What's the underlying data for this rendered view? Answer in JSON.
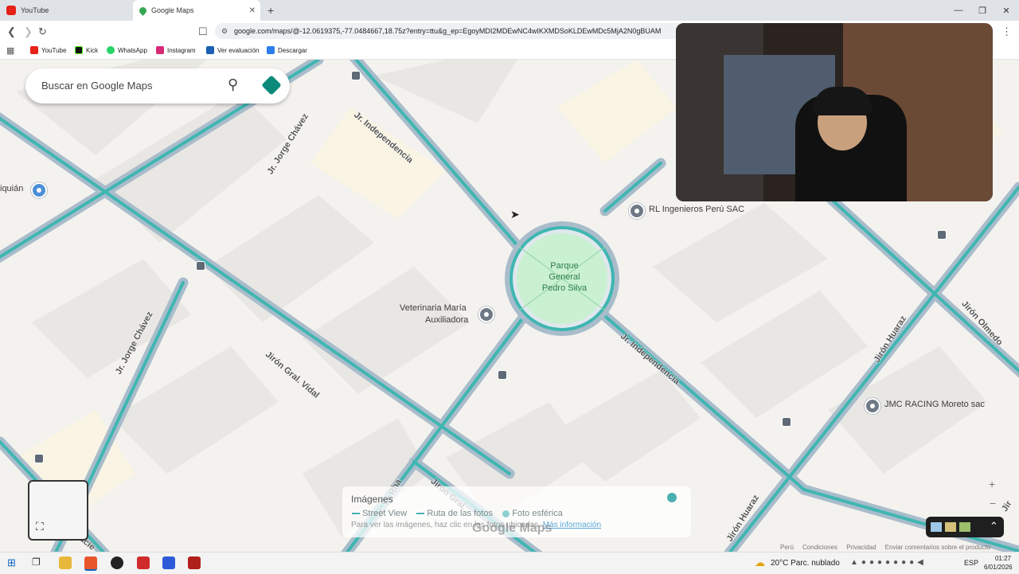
{
  "browser": {
    "tabs": [
      {
        "label": "YouTube",
        "icon": "youtube-icon",
        "active": false
      },
      {
        "label": "Google Maps",
        "icon": "maps-pin-icon",
        "active": true
      }
    ],
    "new_tab_symbol": "+",
    "url": "google.com/maps/@-12.0619375,-77.0484667,18.75z?entry=ttu&g_ep=EgoyMDI2MDEwNC4wIKXMDSoKLDEwMDc5MjA2N0gBUAM",
    "bookmarks": [
      {
        "label": "YouTube",
        "icon": "youtube-icon"
      },
      {
        "label": "Kick",
        "icon": "kick-icon"
      },
      {
        "label": "WhatsApp",
        "icon": "whatsapp-icon"
      },
      {
        "label": "Instagram",
        "icon": "instagram-icon"
      },
      {
        "label": "Ver evaluación",
        "icon": "doc-icon"
      },
      {
        "label": "Descargar",
        "icon": "download-icon"
      }
    ]
  },
  "search": {
    "placeholder": "Buscar en Google Maps"
  },
  "map": {
    "park": [
      "Parque",
      "General",
      "Pedro Silva"
    ],
    "places": [
      {
        "name": "RL Ingenieros Perú SAC"
      },
      {
        "name": "Veterinaria María"
      },
      {
        "name": "Auxiliadora"
      },
      {
        "name": "JMC RACING Moreto sac"
      },
      {
        "name": "iquián"
      }
    ],
    "streets": {
      "jorge_chavez_top": "Jr. Jorge Chávez",
      "jorge_chavez_bottom": "Jr. Jorge Chávez",
      "independencia_top": "Jr. Independencia",
      "independencia_bottom": "Jr. Independencia",
      "gral_vidal": "Jirón Gral. Vidal",
      "huaraz_right": "Jirón Huaraz",
      "huaraz_bottom": "Jirón Huaraz",
      "olmedo": "Jirón Olmedo",
      "gral_bottom": "Jirón Gral.",
      "bottom_partial": "Jr. Yy Rha",
      "bottom_left_partial": "racie",
      "right_edge_partial": "Jir"
    }
  },
  "imagery": {
    "title": "Imágenes",
    "legend": [
      "Street View",
      "Ruta de las fotos",
      "Foto esférica"
    ],
    "hint": "Para ver las imágenes, haz clic en las fotos ubicadas.",
    "link": "Más información",
    "watermark": "Google Maps"
  },
  "footer_links": [
    "Perú",
    "Condiciones",
    "Privacidad",
    "Enviar comentarios sobre el producto"
  ],
  "taskbar": {
    "weather": "20°C  Parc. nublado",
    "lang": "ESP",
    "time": "01:27",
    "date": "6/01/2026"
  },
  "colors": {
    "road_teal": "#3fb6b2",
    "road_edge": "#9fb3c1",
    "park": "#c9f0d0",
    "map_bg": "#f4f2ee"
  }
}
